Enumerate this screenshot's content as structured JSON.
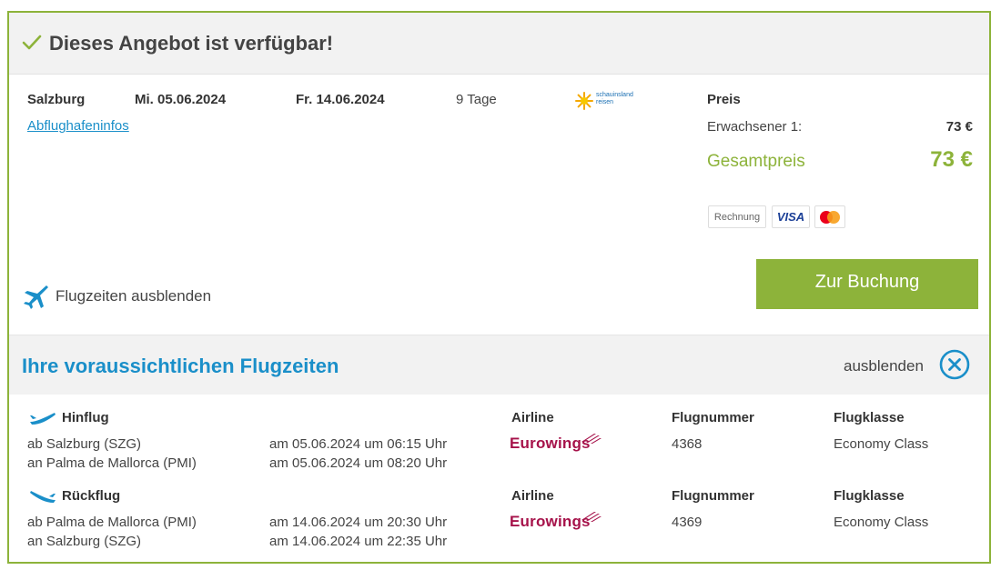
{
  "header": {
    "title": "Dieses Angebot ist verfügbar!"
  },
  "offer": {
    "departure_airport": "Salzburg",
    "date_out": "Mi. 05.06.2024",
    "date_back": "Fr. 14.06.2024",
    "duration": "9 Tage",
    "airport_info_link": "Abflughafeninfos",
    "operator_logo_line1": "schauinsland",
    "operator_logo_line2": "reisen"
  },
  "price": {
    "heading": "Preis",
    "adult_label": "Erwachsener 1:",
    "adult_value": "73 €",
    "total_label": "Gesamtpreis",
    "total_value": "73 €",
    "payment_methods": [
      "Rechnung",
      "VISA"
    ]
  },
  "actions": {
    "book_button": "Zur Buchung",
    "toggle_flight_times": "Flugzeiten ausblenden"
  },
  "flight_section": {
    "title": "Ihre voraussichtlichen Flugzeiten",
    "hide_label": "ausblenden"
  },
  "flights": [
    {
      "label": "Hinflug",
      "airline_header": "Airline",
      "number_header": "Flugnummer",
      "class_header": "Flugklasse",
      "from": "ab Salzburg (SZG)",
      "to": "an Palma de Mallorca (PMI)",
      "dep_time": "am 05.06.2024 um 06:15 Uhr",
      "arr_time": "am 05.06.2024 um 08:20 Uhr",
      "airline": "Eurowings",
      "number": "4368",
      "class": "Economy Class"
    },
    {
      "label": "Rückflug",
      "airline_header": "Airline",
      "number_header": "Flugnummer",
      "class_header": "Flugklasse",
      "from": "ab Palma de Mallorca (PMI)",
      "to": "an Salzburg (SZG)",
      "dep_time": "am 14.06.2024 um 20:30 Uhr",
      "arr_time": "am 14.06.2024 um 22:35 Uhr",
      "airline": "Eurowings",
      "number": "4369",
      "class": "Economy Class"
    }
  ],
  "colors": {
    "accent_green": "#8db33a",
    "accent_blue": "#1a8fc9",
    "eurowings": "#a6124a"
  }
}
